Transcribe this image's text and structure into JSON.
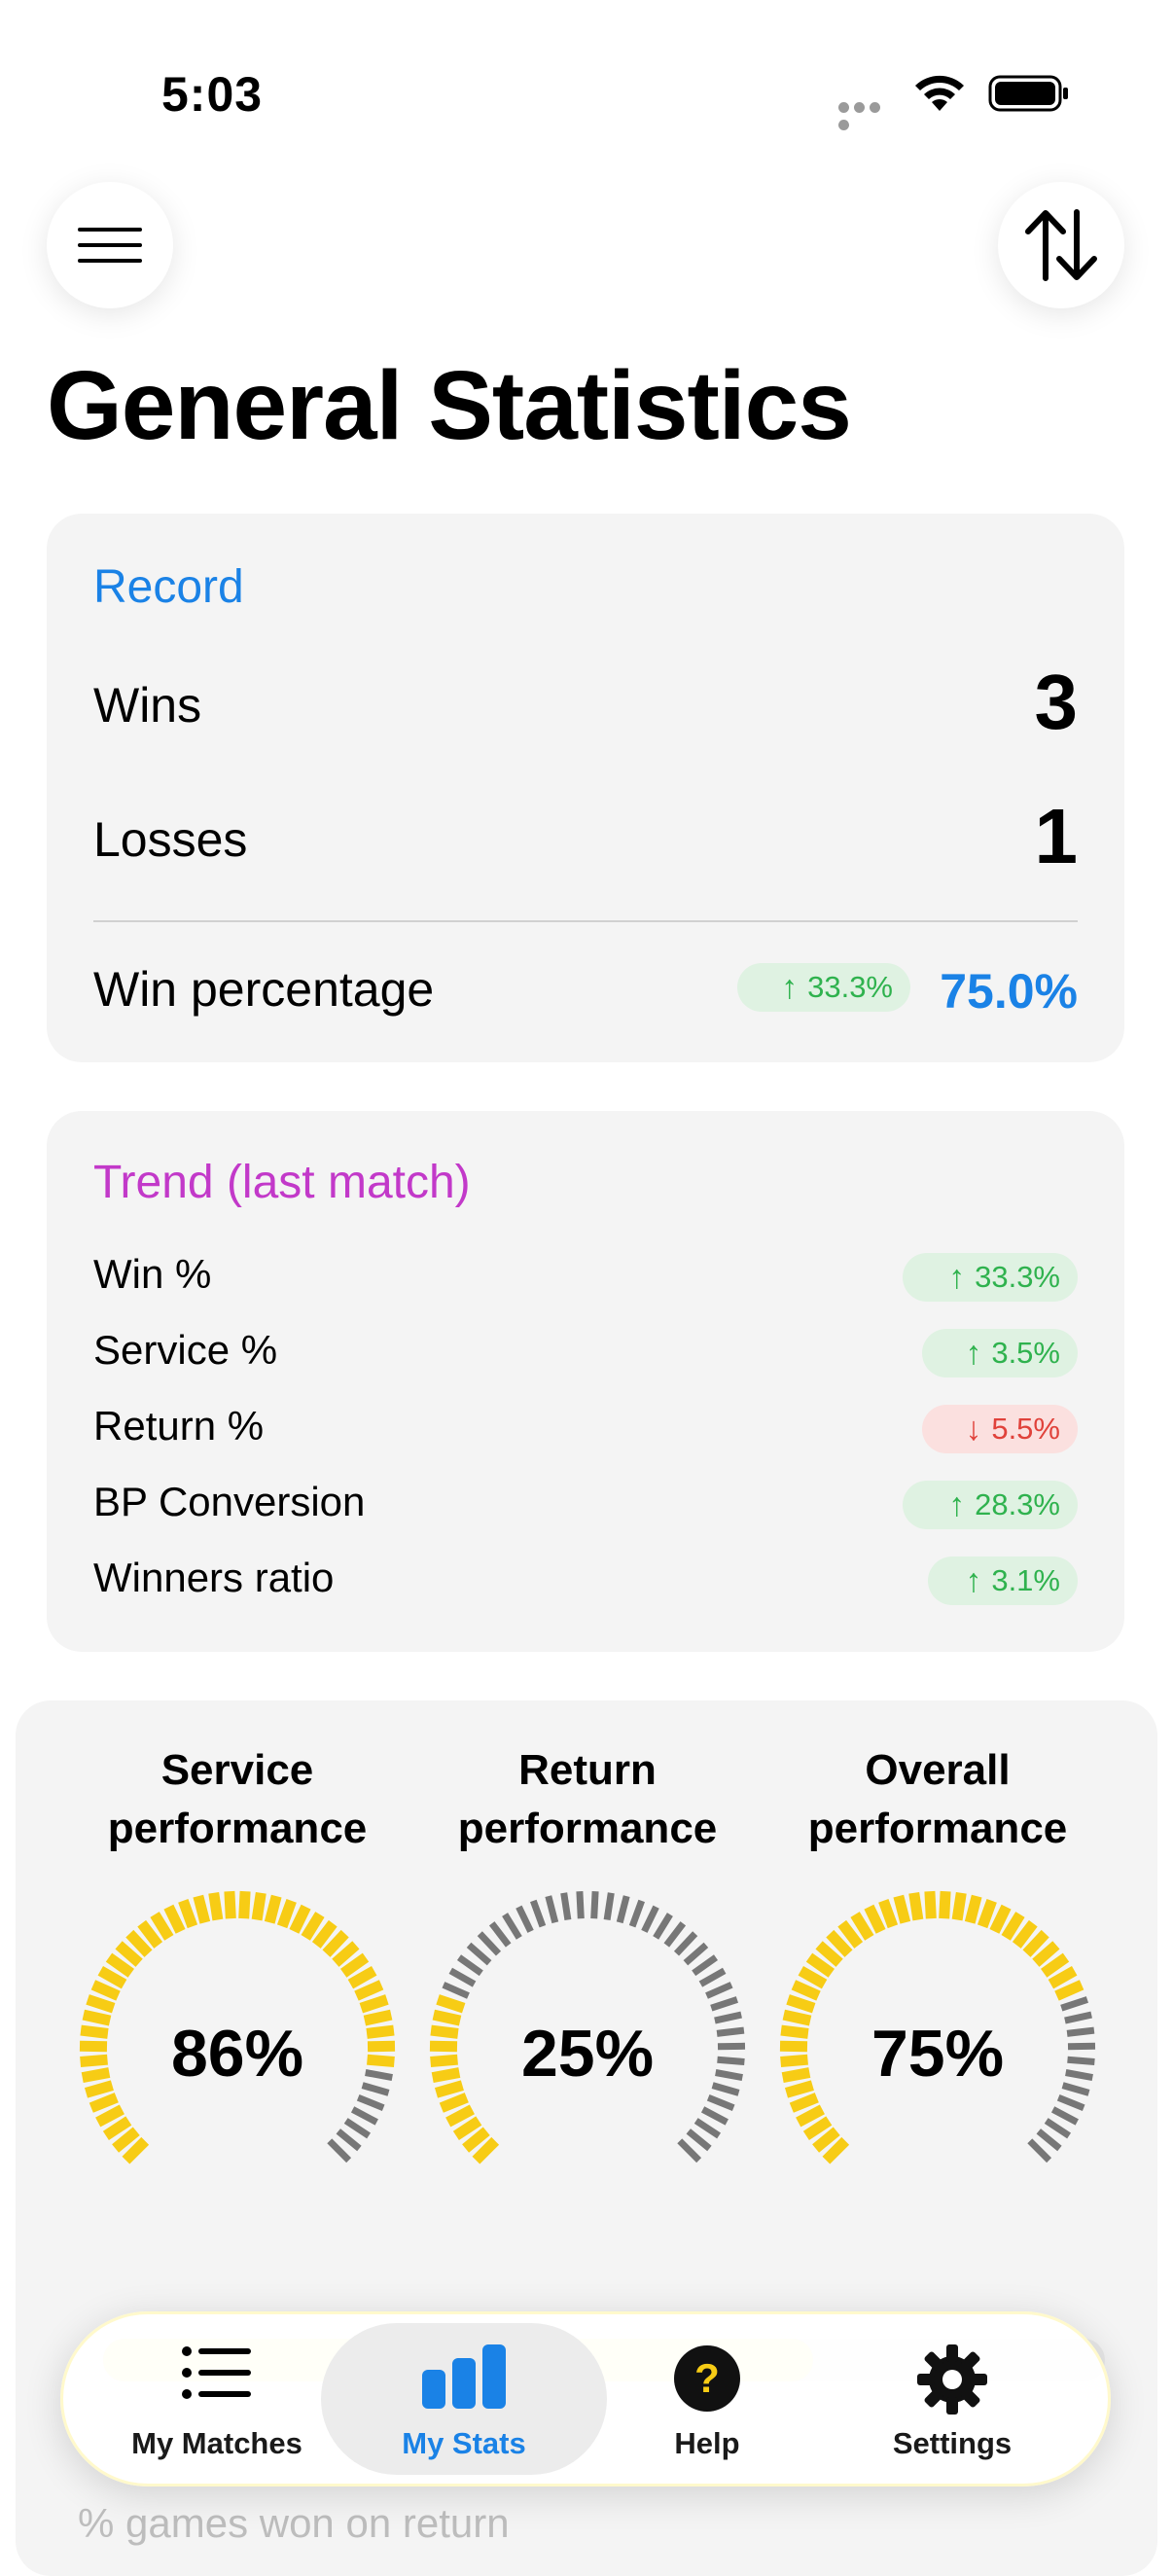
{
  "status_bar": {
    "time": "5:03"
  },
  "header": {
    "title": "General Statistics"
  },
  "record": {
    "title": "Record",
    "wins_label": "Wins",
    "wins_value": "3",
    "losses_label": "Losses",
    "losses_value": "1",
    "win_pct_label": "Win percentage",
    "win_pct_change": "33.3%",
    "win_pct_change_direction": "up",
    "win_pct_value": "75.0%"
  },
  "trend": {
    "title": "Trend (last match)",
    "rows": [
      {
        "label": "Win %",
        "change": "33.3%",
        "direction": "up"
      },
      {
        "label": "Service %",
        "change": "3.5%",
        "direction": "up"
      },
      {
        "label": "Return %",
        "change": "5.5%",
        "direction": "down"
      },
      {
        "label": "BP Conversion",
        "change": "28.3%",
        "direction": "up"
      },
      {
        "label": "Winners ratio",
        "change": "3.1%",
        "direction": "up"
      }
    ]
  },
  "performance": {
    "gauges": [
      {
        "label_line1": "Service",
        "label_line2": "performance",
        "value_text": "86%",
        "fraction": 0.86
      },
      {
        "label_line1": "Return",
        "label_line2": "performance",
        "value_text": "25%",
        "fraction": 0.25
      },
      {
        "label_line1": "Overall",
        "label_line2": "performance",
        "value_text": "75%",
        "fraction": 0.75
      }
    ],
    "games_won_on_return_label": "% games won on return"
  },
  "tab_bar": {
    "tabs": [
      {
        "label": "My Matches",
        "icon": "list-icon",
        "active": false
      },
      {
        "label": "My Stats",
        "icon": "bar-chart-icon",
        "active": true
      },
      {
        "label": "Help",
        "icon": "help-icon",
        "active": false
      },
      {
        "label": "Settings",
        "icon": "gear-icon",
        "active": false
      }
    ]
  },
  "colors": {
    "accent_blue": "#1a82e6",
    "trend_purple": "#c239c9",
    "up_green": "#2fb24e",
    "down_red": "#e0423b",
    "gauge_yellow": "#f7cc15",
    "gauge_gray": "#777777"
  }
}
